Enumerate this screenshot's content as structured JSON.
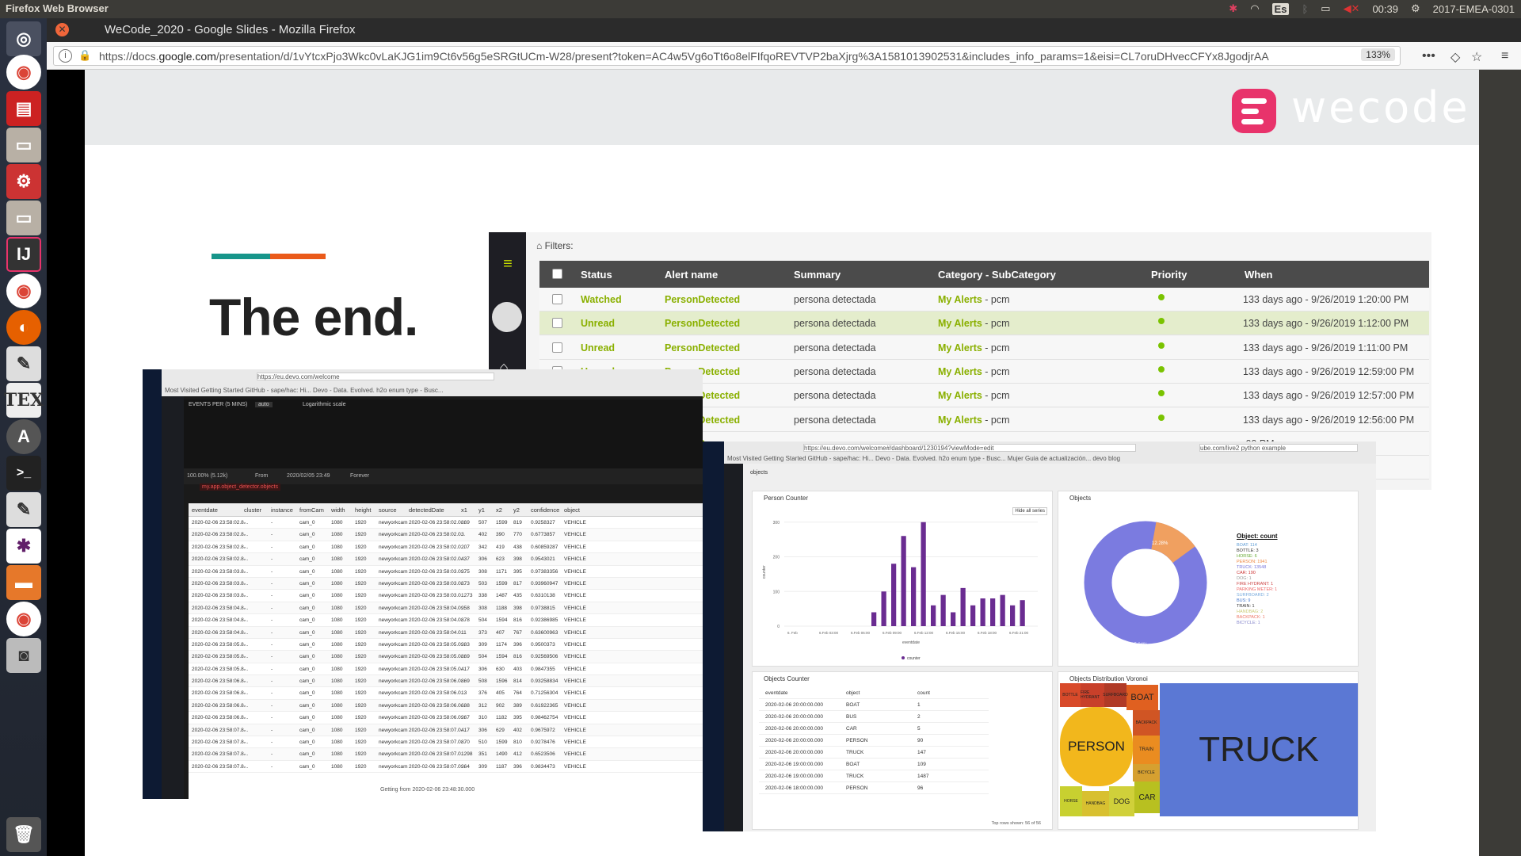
{
  "desktop": {
    "app_name": "Firefox Web Browser",
    "clock": "00:39",
    "keyboard": "Es",
    "user": "2017-EMEA-0301"
  },
  "window": {
    "title": "WeCode_2020 - Google Slides - Mozilla Firefox"
  },
  "browser": {
    "url_prefix": "https://docs.",
    "url_domain": "google.com",
    "url_rest": "/presentation/d/1vYtcxPjo3Wkc0vLaKJG1im9Ct6v56g5eSRGtUCm-W28/present?token=AC4w5Vg6oTt6o8elFIfqoREVTVP2baXjrg%3A1581013902531&includes_info_params=1&eisi=CL7oruDHvecCFYx8JgodjrAA",
    "zoom": "133%"
  },
  "slide": {
    "logo_text": "wecode",
    "headline": "The end."
  },
  "alerts": {
    "filters_label": "Filters:",
    "columns": [
      "Status",
      "Alert name",
      "Summary",
      "Category - SubCategory",
      "Priority",
      "When"
    ],
    "category": "My Alerts",
    "subcategory": " - pcm",
    "rows": [
      {
        "status": "Watched",
        "name": "PersonDetected",
        "summary": "persona detectada",
        "when": "133 days ago - 9/26/2019 1:20:00 PM"
      },
      {
        "status": "Unread",
        "name": "PersonDetected",
        "summary": "persona detectada",
        "when": "133 days ago - 9/26/2019 1:12:00 PM"
      },
      {
        "status": "Unread",
        "name": "PersonDetected",
        "summary": "persona detectada",
        "when": "133 days ago - 9/26/2019 1:11:00 PM"
      },
      {
        "status": "Unread",
        "name": "PersonDetected",
        "summary": "persona detectada",
        "when": "133 days ago - 9/26/2019 12:59:00 PM"
      },
      {
        "status": "Unread",
        "name": "PersonDetected",
        "summary": "persona detectada",
        "when": "133 days ago - 9/26/2019 12:57:00 PM"
      },
      {
        "status": "Unread",
        "name": "PersonDetected",
        "summary": "persona detectada",
        "when": "133 days ago - 9/26/2019 12:56:00 PM"
      },
      {
        "status": "Unread",
        "name": "PersonD",
        "summary": "",
        "when": ":00 PM"
      },
      {
        "status": "Unread",
        "name": "PersonDe",
        "summary": "",
        "when": ":00 PM"
      }
    ]
  },
  "left_screen": {
    "url": "https://eu.devo.com/welcome",
    "bookmarks": "Most Visited  Getting Started  GitHub - sape/hac: Hi...  Devo - Data. Evolved.  h2o enum type - Busc...",
    "events_label": "EVENTS PER (5 MINS)",
    "auto": "auto",
    "log_scale": "Logarithmic scale",
    "range_from": "From",
    "range_date": "2020/02/05 23:49",
    "range_forever": "Forever",
    "query": "my.app.object_detector.objects",
    "pct": "100.00% (5.12k)",
    "footer": "Getting from 2020-02-06 23:48:30.000",
    "columns": [
      "eventdate",
      "cluster",
      "instance",
      "fromCam",
      "width",
      "height",
      "source",
      "detectedDate",
      "x1",
      "y1",
      "x2",
      "y2",
      "confidence",
      "object"
    ],
    "rows": [
      [
        "2020-02-06 23:58:02.8...",
        "-",
        "-",
        "cam_0",
        "1080",
        "1920",
        "newyorkcam",
        "2020-02-06 23:58:02.0...",
        "869",
        "507",
        "1599",
        "819",
        "0.9258327",
        "VEHICLE"
      ],
      [
        "2020-02-06 23:58:02.8...",
        "-",
        "-",
        "cam_0",
        "1080",
        "1920",
        "newyorkcam",
        "2020-02-06 23:58:02.0...",
        "3",
        "402",
        "390",
        "770",
        "0.6773857",
        "VEHICLE"
      ],
      [
        "2020-02-06 23:58:02.8...",
        "-",
        "-",
        "cam_0",
        "1080",
        "1920",
        "newyorkcam",
        "2020-02-06 23:58:02.0...",
        "207",
        "342",
        "419",
        "438",
        "0.60859287",
        "VEHICLE"
      ],
      [
        "2020-02-06 23:58:02.8...",
        "-",
        "-",
        "cam_0",
        "1080",
        "1920",
        "newyorkcam",
        "2020-02-06 23:58:02.0...",
        "437",
        "306",
        "623",
        "398",
        "0.9543021",
        "VEHICLE"
      ],
      [
        "2020-02-06 23:58:03.8...",
        "-",
        "-",
        "cam_0",
        "1080",
        "1920",
        "newyorkcam",
        "2020-02-06 23:58:03.0...",
        "975",
        "308",
        "1171",
        "395",
        "0.97383356",
        "VEHICLE"
      ],
      [
        "2020-02-06 23:58:03.8...",
        "-",
        "-",
        "cam_0",
        "1080",
        "1920",
        "newyorkcam",
        "2020-02-06 23:58:03.0...",
        "873",
        "503",
        "1599",
        "817",
        "0.93960947",
        "VEHICLE"
      ],
      [
        "2020-02-06 23:58:03.8...",
        "-",
        "-",
        "cam_0",
        "1080",
        "1920",
        "newyorkcam",
        "2020-02-06 23:58:03.0...",
        "1273",
        "338",
        "1487",
        "435",
        "0.6310138",
        "VEHICLE"
      ],
      [
        "2020-02-06 23:58:04.8...",
        "-",
        "-",
        "cam_0",
        "1080",
        "1920",
        "newyorkcam",
        "2020-02-06 23:58:04.0...",
        "958",
        "308",
        "1188",
        "398",
        "0.9738815",
        "VEHICLE"
      ],
      [
        "2020-02-06 23:58:04.8...",
        "-",
        "-",
        "cam_0",
        "1080",
        "1920",
        "newyorkcam",
        "2020-02-06 23:58:04.0...",
        "878",
        "504",
        "1594",
        "816",
        "0.92386985",
        "VEHICLE"
      ],
      [
        "2020-02-06 23:58:04.8...",
        "-",
        "-",
        "cam_0",
        "1080",
        "1920",
        "newyorkcam",
        "2020-02-06 23:58:04.0...",
        "11",
        "373",
        "407",
        "767",
        "0.63600963",
        "VEHICLE"
      ],
      [
        "2020-02-06 23:58:05.8...",
        "-",
        "-",
        "cam_0",
        "1080",
        "1920",
        "newyorkcam",
        "2020-02-06 23:58:05.0...",
        "983",
        "309",
        "1174",
        "396",
        "0.9500373",
        "VEHICLE"
      ],
      [
        "2020-02-06 23:58:05.8...",
        "-",
        "-",
        "cam_0",
        "1080",
        "1920",
        "newyorkcam",
        "2020-02-06 23:58:05.0...",
        "869",
        "504",
        "1594",
        "816",
        "0.92569506",
        "VEHICLE"
      ],
      [
        "2020-02-06 23:58:05.8...",
        "-",
        "-",
        "cam_0",
        "1080",
        "1920",
        "newyorkcam",
        "2020-02-06 23:58:05.0...",
        "417",
        "306",
        "630",
        "403",
        "0.9847355",
        "VEHICLE"
      ],
      [
        "2020-02-06 23:58:06.8...",
        "-",
        "-",
        "cam_0",
        "1080",
        "1920",
        "newyorkcam",
        "2020-02-06 23:58:06.0...",
        "869",
        "508",
        "1596",
        "814",
        "0.93258834",
        "VEHICLE"
      ],
      [
        "2020-02-06 23:58:06.8...",
        "-",
        "-",
        "cam_0",
        "1080",
        "1920",
        "newyorkcam",
        "2020-02-06 23:58:06.0...",
        "13",
        "376",
        "405",
        "764",
        "0.71256304",
        "VEHICLE"
      ],
      [
        "2020-02-06 23:58:06.8...",
        "-",
        "-",
        "cam_0",
        "1080",
        "1920",
        "newyorkcam",
        "2020-02-06 23:58:06.0...",
        "688",
        "312",
        "902",
        "389",
        "0.61922365",
        "VEHICLE"
      ],
      [
        "2020-02-06 23:58:06.8...",
        "-",
        "-",
        "cam_0",
        "1080",
        "1920",
        "newyorkcam",
        "2020-02-06 23:58:06.0...",
        "967",
        "310",
        "1182",
        "395",
        "0.98462754",
        "VEHICLE"
      ],
      [
        "2020-02-06 23:58:07.8...",
        "-",
        "-",
        "cam_0",
        "1080",
        "1920",
        "newyorkcam",
        "2020-02-06 23:58:07.0...",
        "417",
        "306",
        "629",
        "402",
        "0.9675972",
        "VEHICLE"
      ],
      [
        "2020-02-06 23:58:07.8...",
        "-",
        "-",
        "cam_0",
        "1080",
        "1920",
        "newyorkcam",
        "2020-02-06 23:58:07.0...",
        "870",
        "510",
        "1599",
        "810",
        "0.9278476",
        "VEHICLE"
      ],
      [
        "2020-02-06 23:58:07.8...",
        "-",
        "-",
        "cam_0",
        "1080",
        "1920",
        "newyorkcam",
        "2020-02-06 23:58:07.0...",
        "1298",
        "351",
        "1490",
        "412",
        "0.6523506",
        "VEHICLE"
      ],
      [
        "2020-02-06 23:58:07.8...",
        "-",
        "-",
        "cam_0",
        "1080",
        "1920",
        "newyorkcam",
        "2020-02-06 23:58:07.0...",
        "964",
        "309",
        "1187",
        "396",
        "0.9834473",
        "VEHICLE"
      ]
    ]
  },
  "right_screen": {
    "url": "https://eu.devo.com/welcome#/dashboard/1230194?viewMode=edit",
    "url2": "ube.com/live2 python example",
    "bookmarks": "Most Visited  Getting Started  GitHub - sape/hac: Hi...  Devo - Data. Evolved.  h2o enum type - Busc...  Mujer  Guia de actualización...  devo blog",
    "widget_select": "objects",
    "person_counter_title": "Person Counter",
    "hide_all": "Hide all series",
    "xaxis_label": "eventdate",
    "yaxis_label": "counter",
    "legend_counter": "counter",
    "objects_title": "Objects",
    "objects_legend_title": "Object: count",
    "objects_legend": [
      "BOAT: 114",
      "BOTTLE: 3",
      "HORSE: 6",
      "PERSON: 1941",
      "TRUCK: 13548",
      "CAR: 190",
      "DOG: 1",
      "FIRE HYDRANT: 1",
      "PARKING METER: 1",
      "SURFBOARD: 2",
      "BUS: 9",
      "TRAIN: 1",
      "HANDBAG: 2",
      "BACKPACK: 1",
      "BICYCLE: 1"
    ],
    "pie_label_large": "85.84%",
    "pie_label_small": "12.28%",
    "objects_counter_title": "Objects Counter",
    "oc_columns": [
      "eventdate",
      "object",
      "count"
    ],
    "oc_rows": [
      [
        "2020-02-06 20:00:00.000",
        "BOAT",
        "1"
      ],
      [
        "2020-02-06 20:00:00.000",
        "BUS",
        "2"
      ],
      [
        "2020-02-06 20:00:00.000",
        "CAR",
        "5"
      ],
      [
        "2020-02-06 20:00:00.000",
        "PERSON",
        "90"
      ],
      [
        "2020-02-06 20:00:00.000",
        "TRUCK",
        "147"
      ],
      [
        "2020-02-06 19:00:00.000",
        "BOAT",
        "109"
      ],
      [
        "2020-02-06 19:00:00.000",
        "TRUCK",
        "1487"
      ],
      [
        "2020-02-06 18:00:00.000",
        "PERSON",
        "96"
      ]
    ],
    "rows_shown": "Top rows shown: 56 of 56",
    "voronoi_title": "Objects Distribution Voronoi",
    "voronoi_labels": {
      "truck": "TRUCK",
      "person": "PERSON",
      "boat": "BOAT",
      "car": "CAR",
      "dog": "DOG",
      "train": "TRAIN",
      "bicycle": "BICYCLE",
      "horse": "HORSE",
      "handbag": "HANDBAG",
      "bottle": "BOTTLE",
      "fire": "FIRE HYDRANT",
      "surf": "SURFBOARD",
      "backpack": "BACKPACK"
    }
  },
  "chart_data": {
    "type": "bar",
    "title": "Person Counter",
    "xlabel": "eventdate",
    "ylabel": "counter",
    "ylim": [
      0,
      320
    ],
    "yticks": [
      0,
      100,
      200,
      300
    ],
    "xticks": [
      "6. Feb",
      "6.Feb 03:00",
      "6.Feb 06:00",
      "6.Feb 09:00",
      "6.Feb 12:00",
      "6.Feb 15:00",
      "6.Feb 18:00",
      "6.Feb 21:00"
    ],
    "series": [
      {
        "name": "counter",
        "color": "#6a2c91",
        "values": [
          40,
          100,
          180,
          260,
          170,
          300,
          60,
          90,
          40,
          110,
          60,
          80,
          80,
          90,
          60,
          75
        ]
      }
    ]
  }
}
